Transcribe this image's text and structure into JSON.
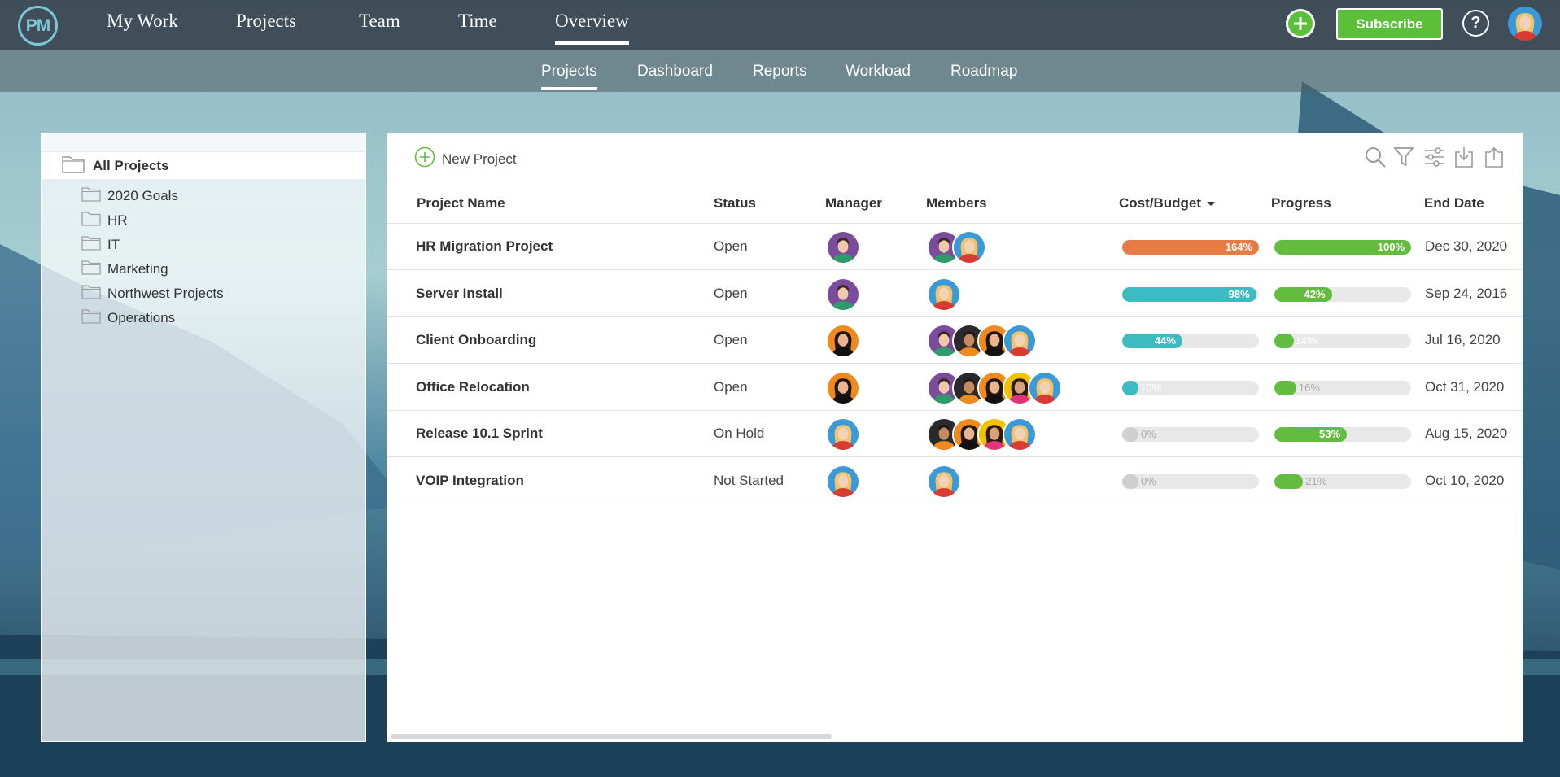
{
  "colors": {
    "accent_green": "#5cbf3a",
    "over_budget": "#e87a46",
    "budget_teal": "#3cbcc2",
    "progress_green": "#63bc3f",
    "logo_teal": "#79c7d8"
  },
  "logo": {
    "text": "PM"
  },
  "topnav": {
    "items": [
      {
        "label": "My Work"
      },
      {
        "label": "Projects"
      },
      {
        "label": "Team"
      },
      {
        "label": "Time"
      },
      {
        "label": "Overview",
        "active": true
      }
    ],
    "subscribe_label": "Subscribe",
    "help_label": "?",
    "icons": [
      "plus-circle-icon",
      "help-icon",
      "user-avatar"
    ]
  },
  "subnav": {
    "items": [
      {
        "label": "Projects",
        "active": true
      },
      {
        "label": "Dashboard"
      },
      {
        "label": "Reports"
      },
      {
        "label": "Workload"
      },
      {
        "label": "Roadmap"
      }
    ]
  },
  "sidebar": {
    "root": {
      "label": "All Projects"
    },
    "folders": [
      {
        "label": "2020 Goals"
      },
      {
        "label": "HR"
      },
      {
        "label": "IT"
      },
      {
        "label": "Marketing"
      },
      {
        "label": "Northwest Projects"
      },
      {
        "label": "Operations"
      }
    ]
  },
  "toolbar": {
    "new_project_label": "New Project",
    "icons": [
      "search-icon",
      "filter-icon",
      "settings-sliders-icon",
      "import-icon",
      "export-icon"
    ]
  },
  "table": {
    "columns": {
      "name": "Project Name",
      "status": "Status",
      "manager": "Manager",
      "members": "Members",
      "cost": "Cost/Budget",
      "progress": "Progress",
      "end": "End Date"
    },
    "sort_indicator": "descending-caret-icon",
    "rows": [
      {
        "name": "HR Migration Project",
        "status": "Open",
        "manager": "man-purple",
        "members": [
          "man-purple",
          "woman-blonde"
        ],
        "cost": 164,
        "cost_label": "164%",
        "progress": 100,
        "progress_label": "100%",
        "end": "Dec 30, 2020"
      },
      {
        "name": "Server Install",
        "status": "Open",
        "manager": "man-purple",
        "members": [
          "woman-blonde"
        ],
        "cost": 98,
        "cost_label": "98%",
        "progress": 42,
        "progress_label": "42%",
        "end": "Sep 24, 2016"
      },
      {
        "name": "Client Onboarding",
        "status": "Open",
        "manager": "woman-dark",
        "members": [
          "man-purple",
          "man-dark",
          "woman-dark",
          "woman-blonde"
        ],
        "cost": 44,
        "cost_label": "44%",
        "progress": 14,
        "progress_label": "14%",
        "end": "Jul 16, 2020"
      },
      {
        "name": "Office Relocation",
        "status": "Open",
        "manager": "woman-dark",
        "members": [
          "man-purple",
          "man-dark",
          "woman-dark",
          "woman-yellow",
          "woman-blonde"
        ],
        "cost": 10,
        "cost_label": "10%",
        "progress": 16,
        "progress_label": "16%",
        "end": "Oct 31, 2020"
      },
      {
        "name": "Release 10.1 Sprint",
        "status": "On Hold",
        "manager": "woman-blonde",
        "members": [
          "man-dark",
          "woman-dark",
          "woman-yellow",
          "woman-blonde"
        ],
        "cost": 0,
        "cost_label": "0%",
        "progress": 53,
        "progress_label": "53%",
        "end": "Aug 15, 2020"
      },
      {
        "name": "VOIP Integration",
        "status": "Not Started",
        "manager": "woman-blonde",
        "members": [
          "woman-blonde"
        ],
        "cost": 0,
        "cost_label": "0%",
        "progress": 21,
        "progress_label": "21%",
        "end": "Oct 10, 2020"
      }
    ]
  }
}
